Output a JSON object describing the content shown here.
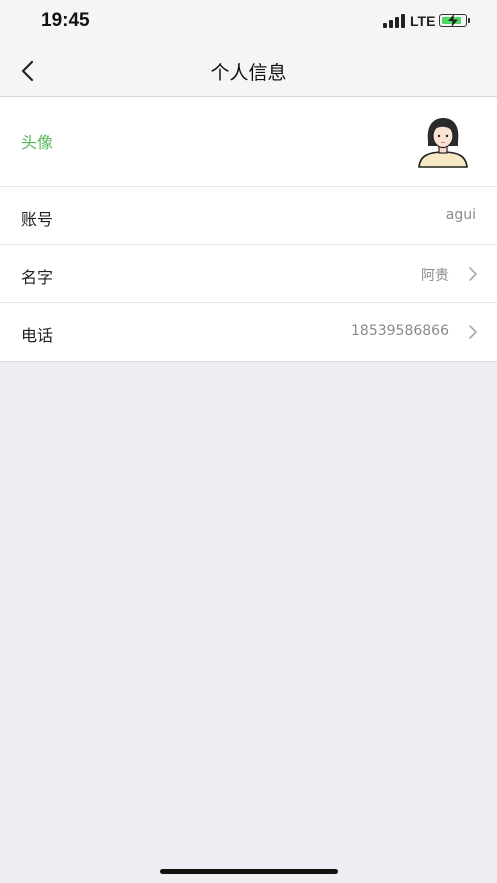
{
  "status_bar": {
    "time": "19:45",
    "network": "LTE",
    "battery_color": "#4cd964",
    "battery_level": 0.85
  },
  "nav": {
    "back_icon": "chevron-left-icon",
    "title": "个人信息"
  },
  "profile": {
    "avatar": {
      "label": "头像",
      "label_color": "#5ab55a",
      "icon": "avatar-girl-icon"
    },
    "rows": [
      {
        "label": "账号",
        "value": "agui",
        "has_arrow": false
      },
      {
        "label": "名字",
        "value": "阿贵",
        "has_arrow": true
      },
      {
        "label": "电话",
        "value": "18539586866",
        "has_arrow": true
      }
    ]
  }
}
